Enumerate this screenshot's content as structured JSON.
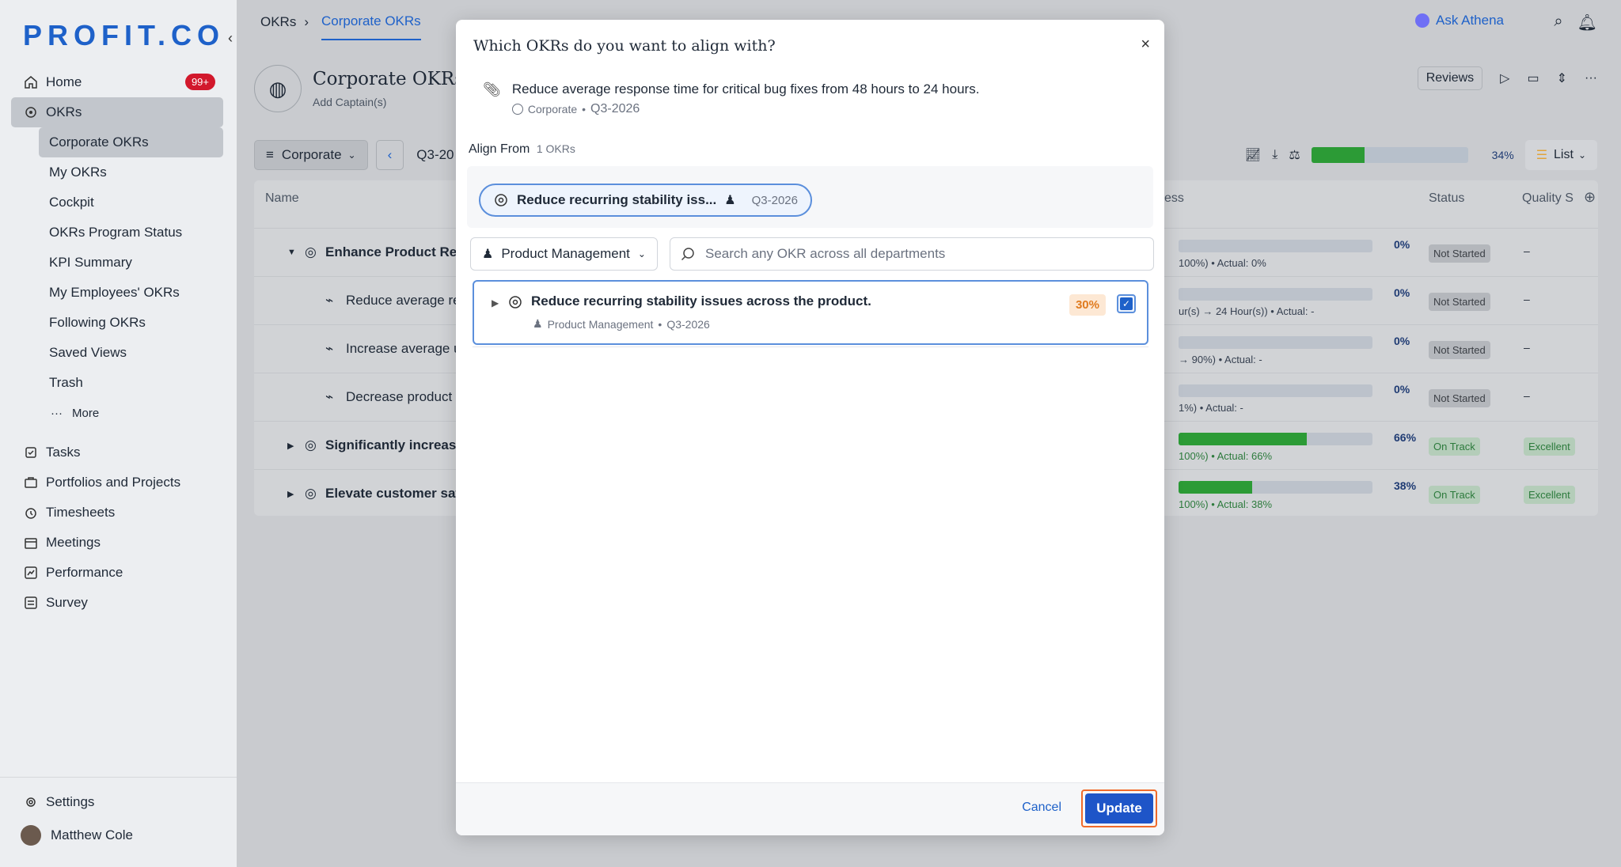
{
  "sidebar": {
    "logo": "PROFIT.CO",
    "collapse": "‹",
    "items": [
      {
        "label": "Home",
        "badge": "99+"
      },
      {
        "label": "OKRs"
      }
    ],
    "okr_sub": [
      "Corporate OKRs",
      "My OKRs",
      "Cockpit",
      "OKRs Program Status",
      "KPI Summary",
      "My Employees' OKRs",
      "Following OKRs",
      "Saved Views",
      "Trash"
    ],
    "more": "More",
    "bottom_items": [
      "Tasks",
      "Portfolios and Projects",
      "Timesheets",
      "Meetings",
      "Performance",
      "Survey"
    ],
    "settings": "Settings",
    "user": "Matthew Cole"
  },
  "topbar": {
    "crumb_root": "OKRs",
    "crumb_sep": "›",
    "crumb_active": "Corporate OKRs",
    "ask": "Ask Athena"
  },
  "page": {
    "title": "Corporate OKRs",
    "captains": "Add Captain(s)",
    "reviews": "Reviews",
    "filter_scope": "Corporate",
    "filter_period": "Q3-20",
    "overall_pct": "34%",
    "overall_value": 0.34,
    "view": "List"
  },
  "table": {
    "headers": {
      "name": "Name",
      "progress": "ess",
      "status": "Status",
      "quality": "Quality S"
    },
    "rows": [
      {
        "name": "Enhance Product Reli",
        "bold": true,
        "level": 0,
        "pct": "0%",
        "fill": 0,
        "actual": "100%) • Actual: 0%",
        "status": "Not Started",
        "quality": "–"
      },
      {
        "name": "Reduce average re",
        "bold": false,
        "level": 1,
        "pct": "0%",
        "fill": 0,
        "actual": "ur(s) → 24 Hour(s)) • Actual: -",
        "status": "Not Started",
        "quality": "–"
      },
      {
        "name": "Increase average u",
        "bold": false,
        "level": 1,
        "pct": "0%",
        "fill": 0,
        "actual": "→ 90%) • Actual: -",
        "status": "Not Started",
        "quality": "–"
      },
      {
        "name": "Decrease product",
        "bold": false,
        "level": 1,
        "pct": "0%",
        "fill": 0,
        "actual": "1%) • Actual: -",
        "status": "Not Started",
        "quality": "–"
      },
      {
        "name": "Significantly increase",
        "bold": true,
        "level": 0,
        "pct": "66%",
        "fill": 0.66,
        "actual": "100%) • Actual: 66%",
        "status": "On Track",
        "quality": "Excellent"
      },
      {
        "name": "Elevate customer sat",
        "bold": true,
        "level": 0,
        "pct": "38%",
        "fill": 0.38,
        "actual": "100%) • Actual: 38%",
        "status": "On Track",
        "quality": "Excellent"
      }
    ]
  },
  "modal": {
    "title": "Which OKRs do you want to align with?",
    "close": "×",
    "source": {
      "title": "Reduce average response time for critical bug fixes from 48 hours to 24 hours.",
      "dept": "Corporate",
      "sep": "•",
      "period": "Q3-2026"
    },
    "align_from_label": "Align From",
    "align_from_count": "1 OKRs",
    "chip": {
      "title": "Reduce recurring stability iss...",
      "period": "Q3-2026"
    },
    "dept_filter": "Product Management",
    "search_placeholder": "Search any OKR across all departments",
    "result": {
      "title": "Reduce recurring stability issues across the product.",
      "dept": "Product Management",
      "sep": "•",
      "period": "Q3-2026",
      "pct": "30%",
      "checked": true
    },
    "cancel": "Cancel",
    "update": "Update"
  },
  "colors": {
    "accent": "#1e61c9",
    "progress": "#2c9b36",
    "badge": "#d2182c",
    "highlight": "#f06a2a"
  }
}
